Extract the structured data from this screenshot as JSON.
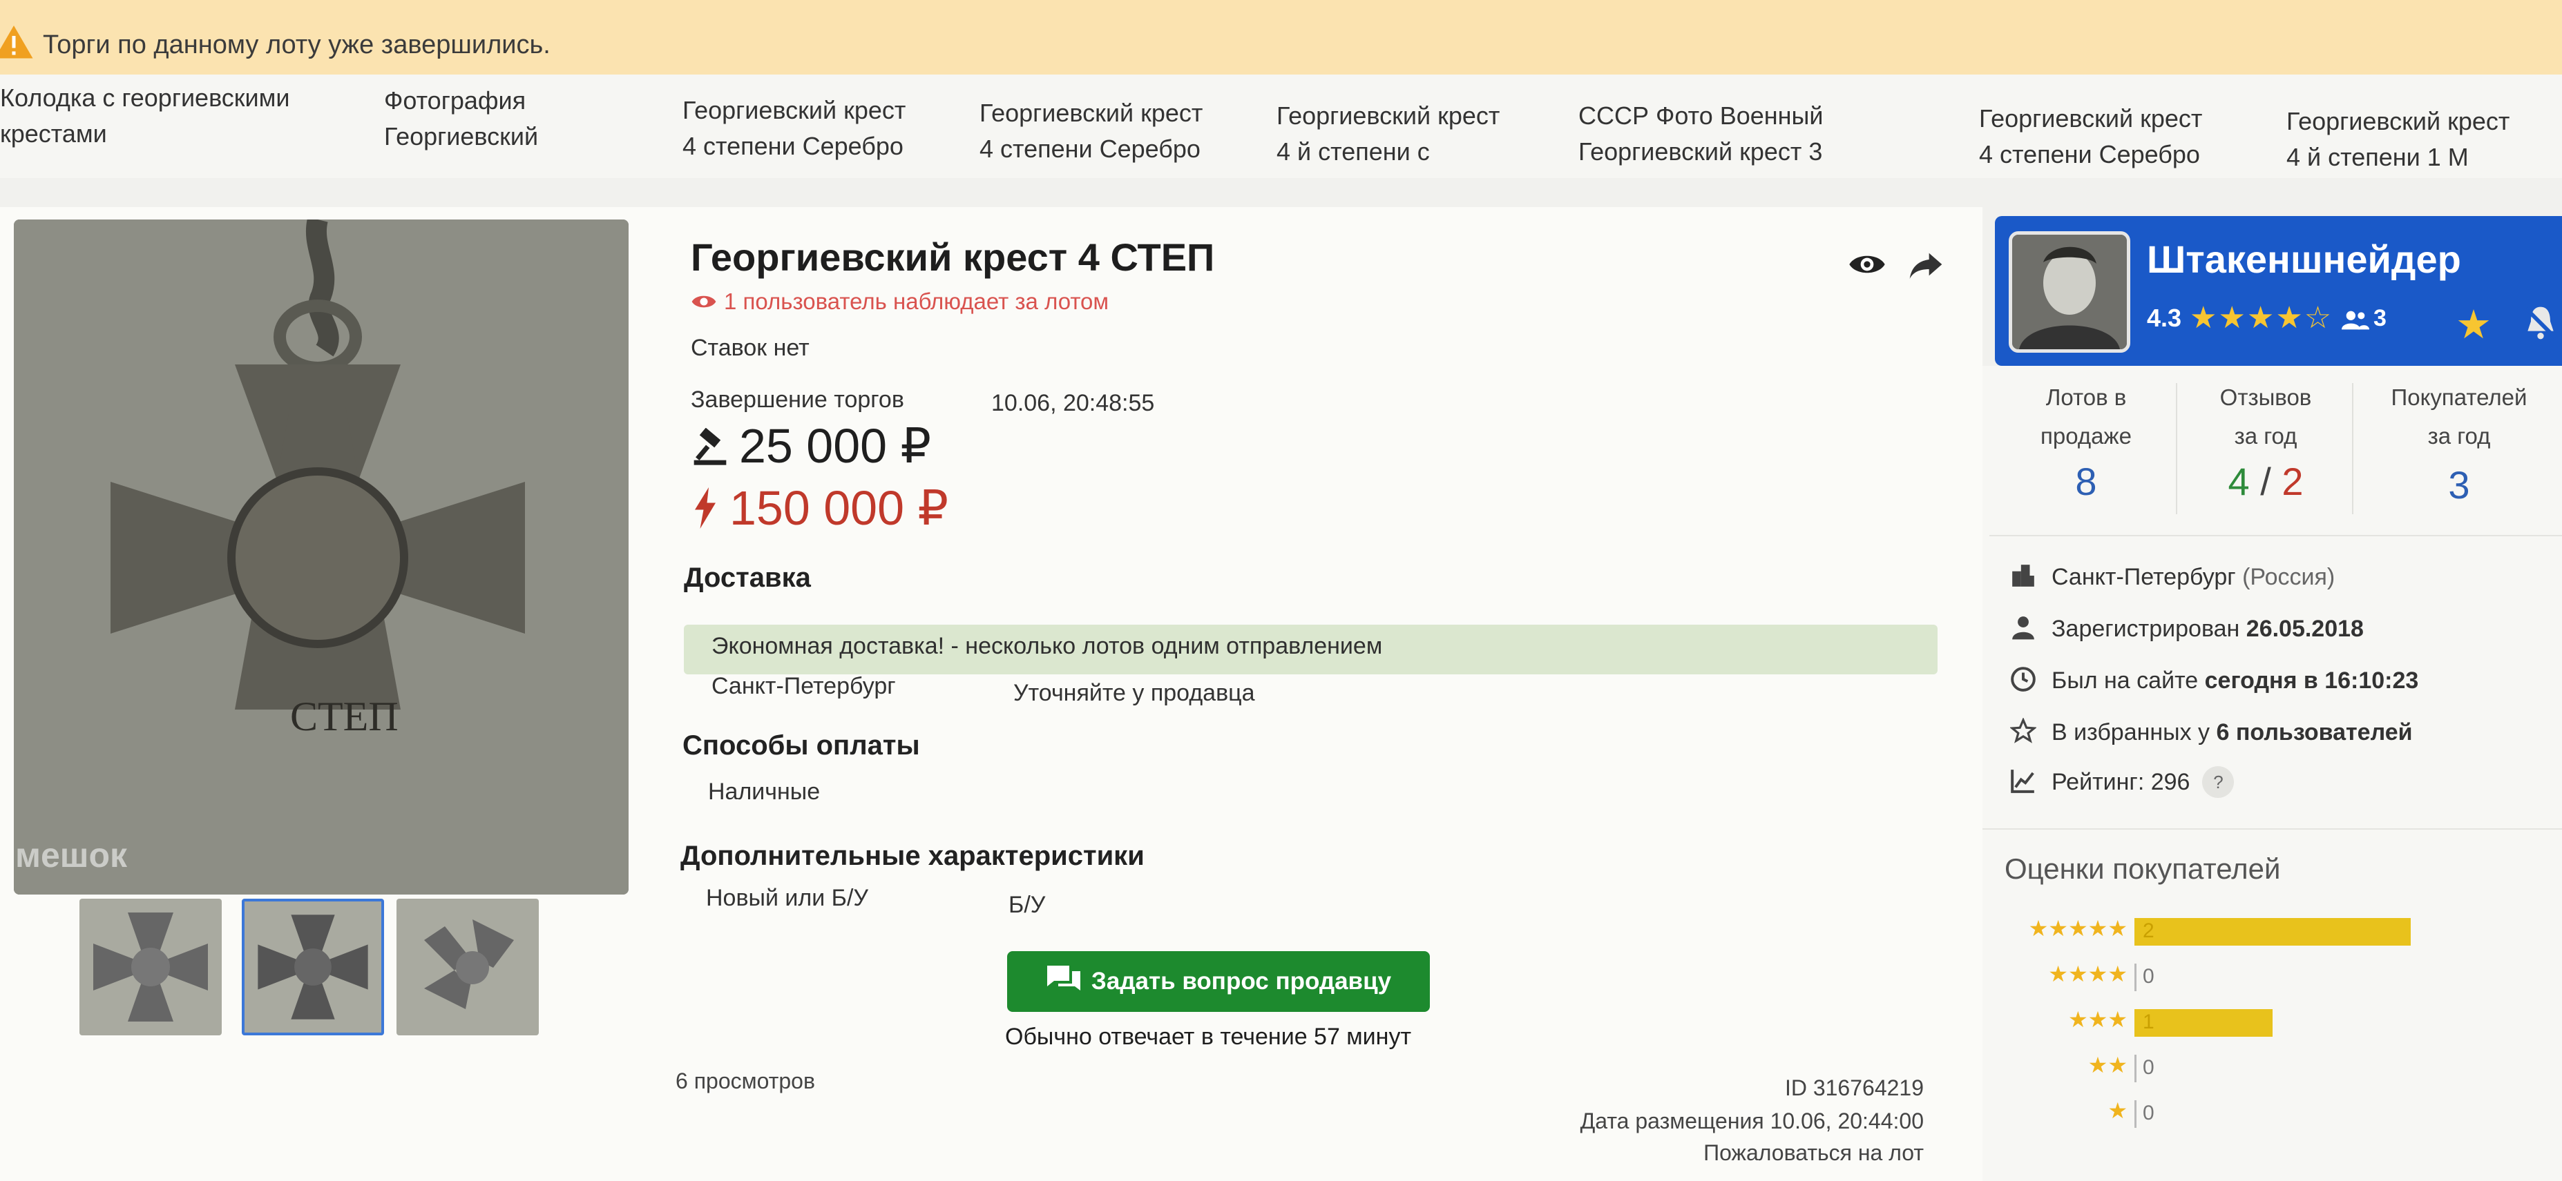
{
  "banner": {
    "text": "Торги по данному лоту уже завершились."
  },
  "similar_lots": [
    {
      "line1": "Колодка с георгиевскими",
      "line2": "крестами"
    },
    {
      "line1": "Фотография",
      "line2": "Георгиевский"
    },
    {
      "line1": "Георгиевский крест",
      "line2": "4 степени Серебро"
    },
    {
      "line1": "Георгиевский крест",
      "line2": "4 степени Серебро"
    },
    {
      "line1": "Георгиевский крест",
      "line2": "4 й степени с"
    },
    {
      "line1": "СССР Фото Военный",
      "line2": "Георгиевский крест 3"
    },
    {
      "line1": "Георгиевский крест",
      "line2": "4 степени Серебро"
    },
    {
      "line1": "Георгиевский крест",
      "line2": "4 й степени 1 М"
    }
  ],
  "gallery": {
    "watermark": "мешок",
    "main_cross_text": "СТЕП"
  },
  "lot": {
    "title": "Георгиевский крест 4 СТЕП",
    "watchers": "1 пользователь наблюдает за лотом",
    "bids": "Ставок нет",
    "end_label": "Завершение торгов",
    "end_value": "10.06, 20:48:55",
    "price": "25 000 ₽",
    "blitz_price": "150 000 ₽"
  },
  "delivery": {
    "title": "Доставка",
    "econ": "Экономная доставка! - несколько лотов одним отправлением",
    "city": "Санкт-Петербург",
    "city_note": "Уточняйте у продавца"
  },
  "payment": {
    "title": "Способы оплаты",
    "method": "Наличные"
  },
  "extra": {
    "title": "Дополнительные характеристики",
    "label": "Новый или Б/У",
    "value": "Б/У"
  },
  "ask": {
    "button": "Задать вопрос продавцу",
    "note": "Обычно отвечает в течение 57 минут"
  },
  "footer": {
    "views": "6 просмотров",
    "id": "ID 316764219",
    "posted": "Дата размещения 10.06, 20:44:00",
    "report": "Пожаловаться на лот"
  },
  "seller": {
    "name": "Штакеншнейдер",
    "rating": "4.3",
    "stars": "★★★★☆",
    "buyers_badge": "3",
    "stats": [
      {
        "label": "Лотов в\nпродаже",
        "value": "8"
      },
      {
        "label": "Отзывов\nза год",
        "value_pos": "4",
        "sep": "/",
        "value_neg": "2"
      },
      {
        "label": "Покупателей\nза год",
        "value": "3"
      }
    ],
    "city": "Санкт-Петербург",
    "country": "(Россия)",
    "registered_label": "Зарегистрирован",
    "registered_date": "26.05.2018",
    "online_label": "Был на сайте",
    "online_value": "сегодня в 16:10:23",
    "favorites_label": "В избранных у",
    "favorites_value": "6 пользователей",
    "rating_line": "Рейтинг: 296",
    "help": "?"
  },
  "reviews": {
    "title": "Оценки покупателей",
    "rows": [
      {
        "stars": "★★★★★",
        "count": "2",
        "share": 1.0
      },
      {
        "stars": "★★★★",
        "count": "0",
        "share": 0
      },
      {
        "stars": "★★★",
        "count": "1",
        "share": 0.5
      },
      {
        "stars": "★★",
        "count": "0",
        "share": 0
      },
      {
        "stars": "★",
        "count": "0",
        "share": 0
      }
    ]
  },
  "colors": {
    "accent": "#1a59c8",
    "button": "#1d8a2e",
    "price_red": "#c0392b",
    "star": "#f0b41e"
  }
}
